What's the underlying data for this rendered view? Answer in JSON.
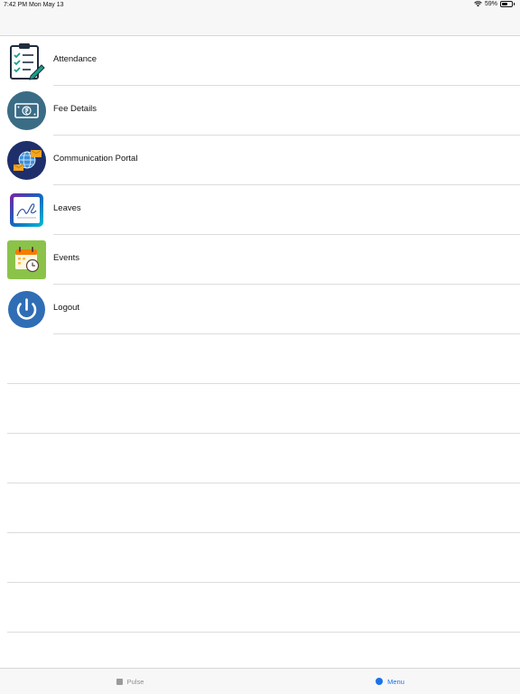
{
  "status_bar": {
    "time_date": "7:42 PM   Mon May 13",
    "battery_text": "59%",
    "battery_level": 0.59,
    "icons": [
      "wifi-icon",
      "battery-icon"
    ]
  },
  "menu": {
    "items": [
      {
        "label": "Attendance",
        "icon": "clipboard-checklist-icon"
      },
      {
        "label": "Fee Details",
        "icon": "rupee-banknote-icon"
      },
      {
        "label": "Communication Portal",
        "icon": "globe-envelope-icon"
      },
      {
        "label": "Leaves",
        "icon": "signature-icon"
      },
      {
        "label": "Events",
        "icon": "calendar-clock-icon"
      },
      {
        "label": "Logout",
        "icon": "power-icon"
      }
    ]
  },
  "tab_bar": {
    "tabs": [
      {
        "label": "Pulse",
        "icon": "square-icon",
        "active": false
      },
      {
        "label": "Menu",
        "icon": "circle-icon",
        "active": true
      }
    ]
  },
  "colors": {
    "accent": "#1a73e8",
    "inactive_tab": "#8e8e93",
    "fee_icon_bg": "#3a6c86",
    "portal_icon_bg": "#1e2f6b",
    "events_icon_bg": "#8bc34a",
    "logout_icon_bg": "#2f6db5"
  }
}
